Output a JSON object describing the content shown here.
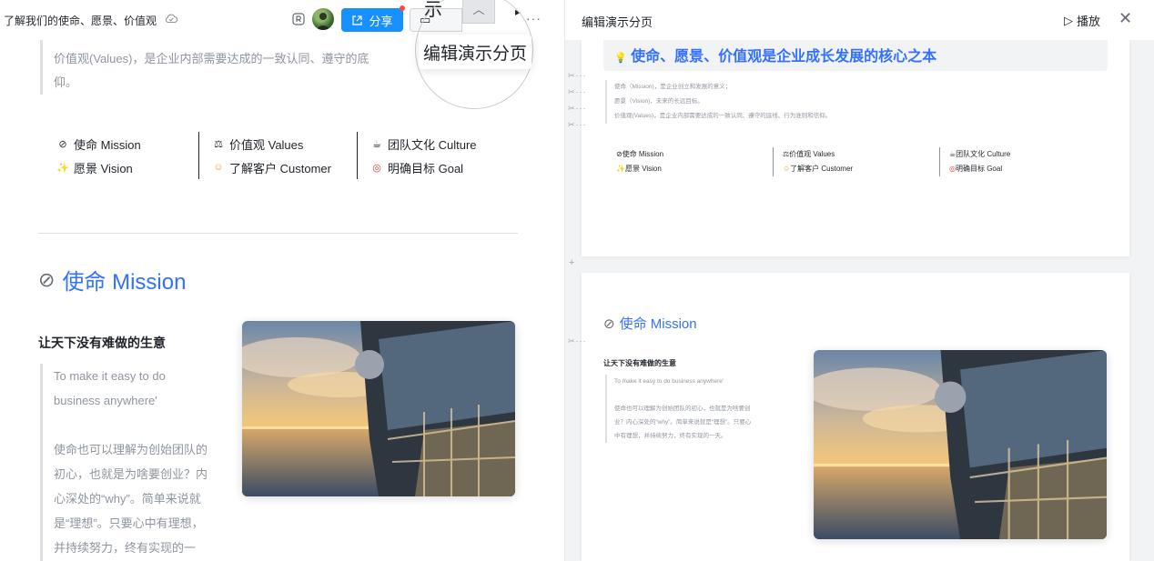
{
  "doc": {
    "title": "了解我们的使命、愿景、价值观",
    "share_label": "分享",
    "present_label": "示",
    "present_large": "示",
    "more_label": "···",
    "tooltip": "编辑演示分页",
    "quote_lines": [
      "价值观(Values)，是企业内部需要达成的一致认同、遵守的底",
      "仰。"
    ],
    "features": {
      "col1": [
        "使命 Mission",
        "愿景 Vision"
      ],
      "col2": [
        "价值观 Values",
        "了解客户 Customer"
      ],
      "col3": [
        "团队文化 Culture",
        "明确目标 Goal"
      ]
    },
    "mission_heading": "使命 Mission",
    "mission_subheading": "让天下没有难做的生意",
    "mission_quote": [
      "To make it easy to do",
      "business anywhere'",
      "",
      "使命也可以理解为创始团队的",
      "初心，也就是为啥要创业？内",
      "心深处的“why”。简单来说就",
      "是“理想”。只要心中有理想，",
      "并持续努力，终有实现的一"
    ]
  },
  "panel": {
    "title": "编辑演示分页",
    "play_label": "播放",
    "slide1": {
      "banner": "使命、愿景、价值观是企业成长发展的核心之本",
      "lines": [
        "使命（Mission)，是企业创立和发展的意义；",
        "愿景（Vision)，未来的长远目标。",
        "价值观(Values)，是企业内部需要达成的一致认同、遵守的底线、行为准则和信仰。"
      ],
      "features": {
        "col1": [
          "使命 Mission",
          "愿景 Vision"
        ],
        "col2": [
          "价值观 Values",
          "了解客户 Customer"
        ],
        "col3": [
          "团队文化 Culture",
          "明确目标 Goal"
        ]
      }
    },
    "slide2": {
      "heading": "使命 Mission",
      "subheading": "让天下没有难做的生意",
      "quote": [
        "To make it easy to do business anywhere'",
        "",
        "使命也可以理解为创始团队的初心，也就是为啥要创",
        "业？内心深处的“why”。简单来说就是“理想”。只要心",
        "中有理想，并持续努力，终有实现的一天。"
      ]
    }
  },
  "colors": {
    "accent": "#3370ff",
    "share_button": "#1890ff",
    "muted_text": "#8f959e"
  }
}
